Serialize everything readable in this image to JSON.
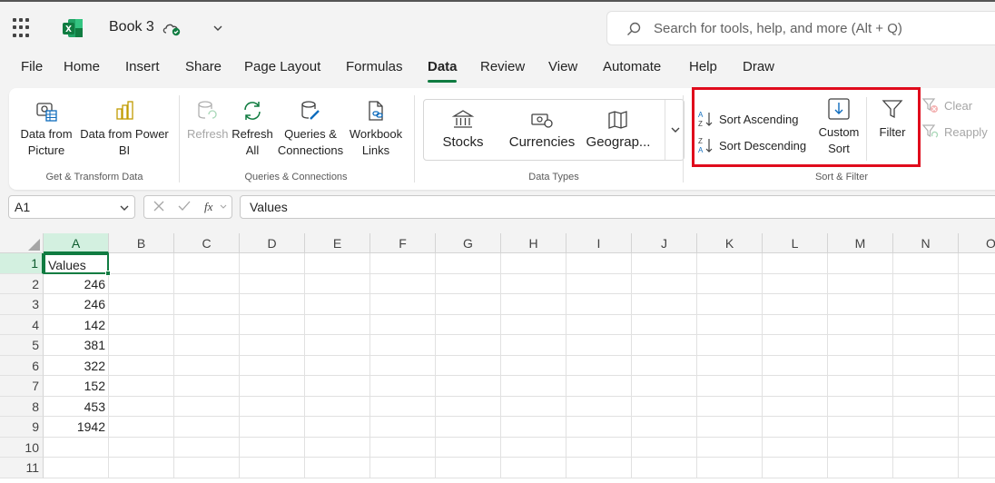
{
  "titlebar": {
    "book_title": "Book 3",
    "search_placeholder": "Search for tools, help, and more (Alt + Q)"
  },
  "tabs": [
    "File",
    "Home",
    "Insert",
    "Share",
    "Page Layout",
    "Formulas",
    "Data",
    "Review",
    "View",
    "Automate",
    "Help",
    "Draw"
  ],
  "active_tab": "Data",
  "ribbon": {
    "get_transform": {
      "from_picture": [
        "Data from",
        "Picture"
      ],
      "from_powerbi": [
        "Data from Power",
        "BI"
      ],
      "label": "Get & Transform Data"
    },
    "queries": {
      "refresh": "Refresh",
      "refresh_all": [
        "Refresh",
        "All"
      ],
      "queries_connections": [
        "Queries &",
        "Connections"
      ],
      "workbook_links": [
        "Workbook",
        "Links"
      ],
      "label": "Queries & Connections"
    },
    "data_types": {
      "stocks": "Stocks",
      "currencies": "Currencies",
      "geography": "Geograp...",
      "label": "Data Types"
    },
    "sort_filter": {
      "sort_ascending": "Sort Ascending",
      "sort_descending": "Sort Descending",
      "custom_sort": [
        "Custom",
        "Sort"
      ],
      "filter": "Filter",
      "clear": "Clear",
      "reapply": "Reapply",
      "label": "Sort & Filter"
    }
  },
  "formula_bar": {
    "name_box": "A1",
    "formula": "Values"
  },
  "sheet": {
    "columns": [
      "A",
      "B",
      "C",
      "D",
      "E",
      "F",
      "G",
      "H",
      "I",
      "J",
      "K",
      "L",
      "M",
      "N",
      "O"
    ],
    "rows": [
      "1",
      "2",
      "3",
      "4",
      "5",
      "6",
      "7",
      "8",
      "9",
      "10",
      "11"
    ],
    "column_a": [
      "Values",
      "246",
      "246",
      "142",
      "381",
      "322",
      "152",
      "453",
      "1942",
      "",
      ""
    ]
  },
  "colors": {
    "accent": "#107c41",
    "highlight": "#e00b1c"
  }
}
